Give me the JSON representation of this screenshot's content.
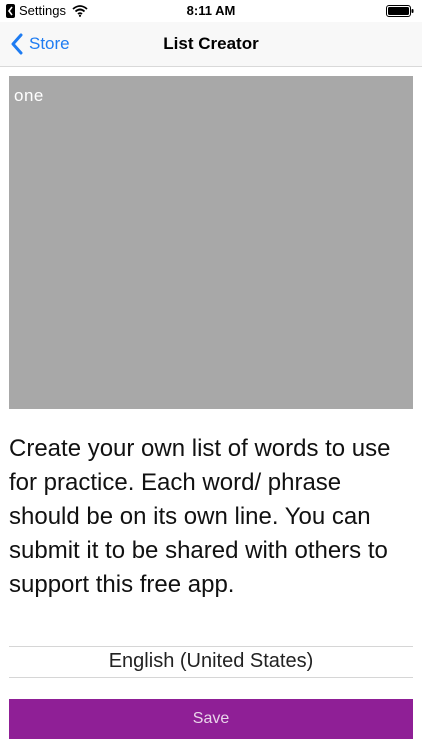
{
  "status_bar": {
    "back_app": "Settings",
    "time": "8:11 AM"
  },
  "nav": {
    "back_label": "Store",
    "title": "List Creator"
  },
  "editor": {
    "text": "one"
  },
  "description": "Create your own list of words to use for practice.  Each word/ phrase should be on its own line.  You can submit it to be shared with others to support this free app.",
  "language_picker": {
    "selected": "English (United States)"
  },
  "save_button": {
    "label": "Save"
  },
  "colors": {
    "accent": "#1e7cf2",
    "save_button": "#8f1f96",
    "text_area": "#a8a8a8"
  },
  "icons": {
    "status_back": "back-arrow-icon",
    "wifi": "wifi-icon",
    "battery": "battery-icon",
    "nav_back": "chevron-left-icon"
  }
}
